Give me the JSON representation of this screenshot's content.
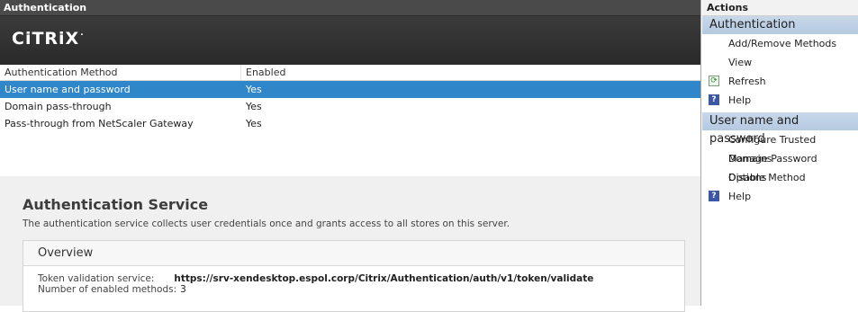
{
  "window": {
    "title": "Authentication"
  },
  "brand": {
    "logo_text": "CiTRiX",
    "logo_dot": "."
  },
  "list": {
    "headers": [
      "Authentication Method",
      "Enabled"
    ],
    "rows": [
      {
        "method": "User name and password",
        "enabled": "Yes",
        "selected": true
      },
      {
        "method": "Domain pass-through",
        "enabled": "Yes",
        "selected": false
      },
      {
        "method": "Pass-through from NetScaler Gateway",
        "enabled": "Yes",
        "selected": false
      }
    ]
  },
  "detail": {
    "title": "Authentication Service",
    "description": "The authentication service collects user credentials once and grants access to all stores on this server.",
    "overview": {
      "heading": "Overview",
      "token_label": "Token validation service:",
      "token_value": "https://srv-xendesktop.espol.corp/Citrix/Authentication/auth/v1/token/validate",
      "methods_label": "Number of enabled methods:",
      "methods_value": "3"
    }
  },
  "actions": {
    "title": "Actions",
    "sections": [
      {
        "heading": "Authentication",
        "items": [
          {
            "label": "Add/Remove Methods",
            "icon": ""
          },
          {
            "label": "View",
            "icon": ""
          },
          {
            "label": "Refresh",
            "icon": "refresh-icon"
          },
          {
            "label": "Help",
            "icon": "help-icon"
          }
        ]
      },
      {
        "heading": "User name and password",
        "items": [
          {
            "label": "Configure Trusted Domains",
            "icon": ""
          },
          {
            "label": "Manage Password Options",
            "icon": ""
          },
          {
            "label": "Disable Method",
            "icon": ""
          },
          {
            "label": "Help",
            "icon": "help-icon"
          }
        ]
      }
    ]
  },
  "colors": {
    "selection": "#2f86c8",
    "banner": "#333333",
    "section_header": "#bfd1e6"
  }
}
